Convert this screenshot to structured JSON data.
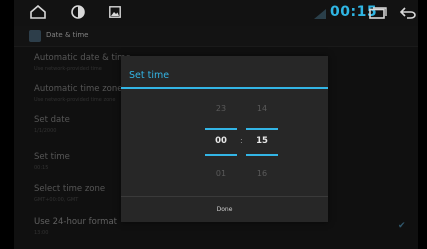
{
  "statusbar": {
    "icons": {
      "home": "home-icon",
      "brightness": "brightness-icon",
      "gallery": "gallery-icon",
      "recents": "recent-apps-icon",
      "back": "back-icon"
    },
    "clock": "00:15",
    "accent": "#33b5e5"
  },
  "actionbar": {
    "title": "Date & time"
  },
  "settings": {
    "items": [
      {
        "title": "Automatic date & time",
        "subtitle": "Use network-provided time"
      },
      {
        "title": "Automatic time zone",
        "subtitle": "Use network-provided time zone"
      },
      {
        "title": "Set date",
        "subtitle": "1/1/2000"
      },
      {
        "title": "Set time",
        "subtitle": "00:15"
      },
      {
        "title": "Select time zone",
        "subtitle": "GMT+00:00, GMT"
      },
      {
        "title": "Use 24-hour format",
        "subtitle": "13:00"
      }
    ],
    "use24hour_checked": true
  },
  "dialog": {
    "title": "Set time",
    "hours": {
      "prev": "23",
      "current": "00",
      "next": "01"
    },
    "minutes": {
      "prev": "14",
      "current": "15",
      "next": "16"
    },
    "separator": ":",
    "done_label": "Done"
  }
}
